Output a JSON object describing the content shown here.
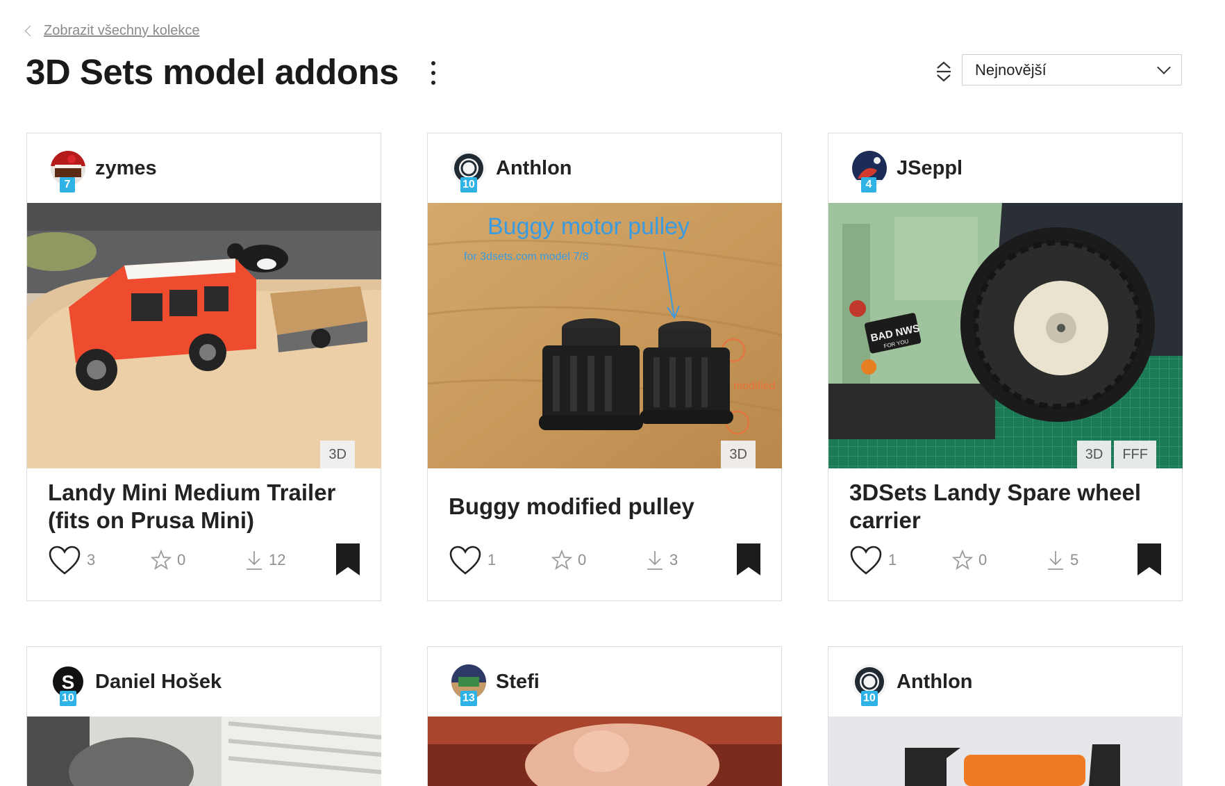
{
  "nav": {
    "back_label": "Zobrazit všechny kolekce"
  },
  "header": {
    "title": "3D Sets model addons"
  },
  "sort": {
    "value": "Nejnovější"
  },
  "colors": {
    "level_badge": "#2fb2e6",
    "text": "#1a1a1a",
    "muted": "#8f8f8f"
  },
  "cards": [
    {
      "author": "zymes",
      "level": "7",
      "tags": [
        "3D"
      ],
      "title": "Landy Mini Medium Trailer (fits on Prusa Mini)",
      "likes": "3",
      "stars": "0",
      "downloads": "12"
    },
    {
      "author": "Anthlon",
      "level": "10",
      "tags": [
        "3D"
      ],
      "title": "Buggy modified pulley",
      "likes": "1",
      "stars": "0",
      "downloads": "3",
      "image_text": {
        "heading": "Buggy motor pulley",
        "sub": "for 3dsets.com model 7/8",
        "note": "modified"
      }
    },
    {
      "author": "JSeppl",
      "level": "4",
      "tags": [
        "3D",
        "FFF"
      ],
      "title": "3DSets Landy Spare wheel carrier",
      "likes": "1",
      "stars": "0",
      "downloads": "5",
      "image_text": {
        "plate": "BAD NWS",
        "plate_sub": "FOR YOU"
      }
    },
    {
      "author": "Daniel Hošek",
      "level": "10"
    },
    {
      "author": "Stefi",
      "level": "13"
    },
    {
      "author": "Anthlon",
      "level": "10"
    }
  ]
}
